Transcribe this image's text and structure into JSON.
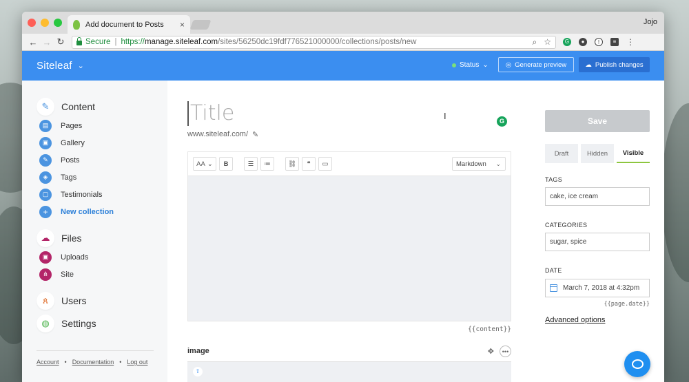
{
  "browser": {
    "tab_title": "Add document to Posts",
    "tab_close": "×",
    "profile_name": "Jojo",
    "secure_label": "Secure",
    "url_proto": "https://",
    "url_host": "manage.siteleaf.com",
    "url_path": "/sites/56250dc19fdf776521000000/collections/posts/new",
    "light_colors": [
      "#fe5f57",
      "#febc2e",
      "#28c840"
    ]
  },
  "header": {
    "brand": "Siteleaf",
    "status_label": "Status",
    "generate_preview": "Generate preview",
    "publish_changes": "Publish changes",
    "accent": "#3b8ef0"
  },
  "sidebar": {
    "content_label": "Content",
    "content_items": [
      {
        "label": "Pages",
        "icon": "page-icon"
      },
      {
        "label": "Gallery",
        "icon": "gallery-icon"
      },
      {
        "label": "Posts",
        "icon": "pencil-icon"
      },
      {
        "label": "Tags",
        "icon": "tag-icon"
      },
      {
        "label": "Testimonials",
        "icon": "document-icon"
      },
      {
        "label": "New collection",
        "icon": "plus-icon"
      }
    ],
    "files_label": "Files",
    "file_items": [
      {
        "label": "Uploads",
        "icon": "image-icon"
      },
      {
        "label": "Site",
        "icon": "sitemap-icon"
      }
    ],
    "users_label": "Users",
    "settings_label": "Settings",
    "footer": {
      "account": "Account",
      "documentation": "Documentation",
      "logout": "Log out",
      "separator": "•"
    }
  },
  "editor": {
    "title_placeholder": "Title",
    "slug": "www.siteleaf.com/",
    "toolbar": {
      "font": "AA",
      "bold": "B",
      "format_select": "Markdown"
    },
    "content_tag": "{{content}}",
    "image_label": "image",
    "more_label": "•••"
  },
  "rpanel": {
    "save": "Save",
    "visibility_tabs": [
      "Draft",
      "Hidden",
      "Visible"
    ],
    "active_tab": "Visible",
    "tags_label": "TAGS",
    "tags_value": "cake, ice cream",
    "categories_label": "CATEGORIES",
    "categories_value": "sugar, spice",
    "date_label": "DATE",
    "date_value": "March 7, 2018 at 4:32pm",
    "date_tag": "{{page.date}}",
    "advanced": "Advanced options"
  }
}
